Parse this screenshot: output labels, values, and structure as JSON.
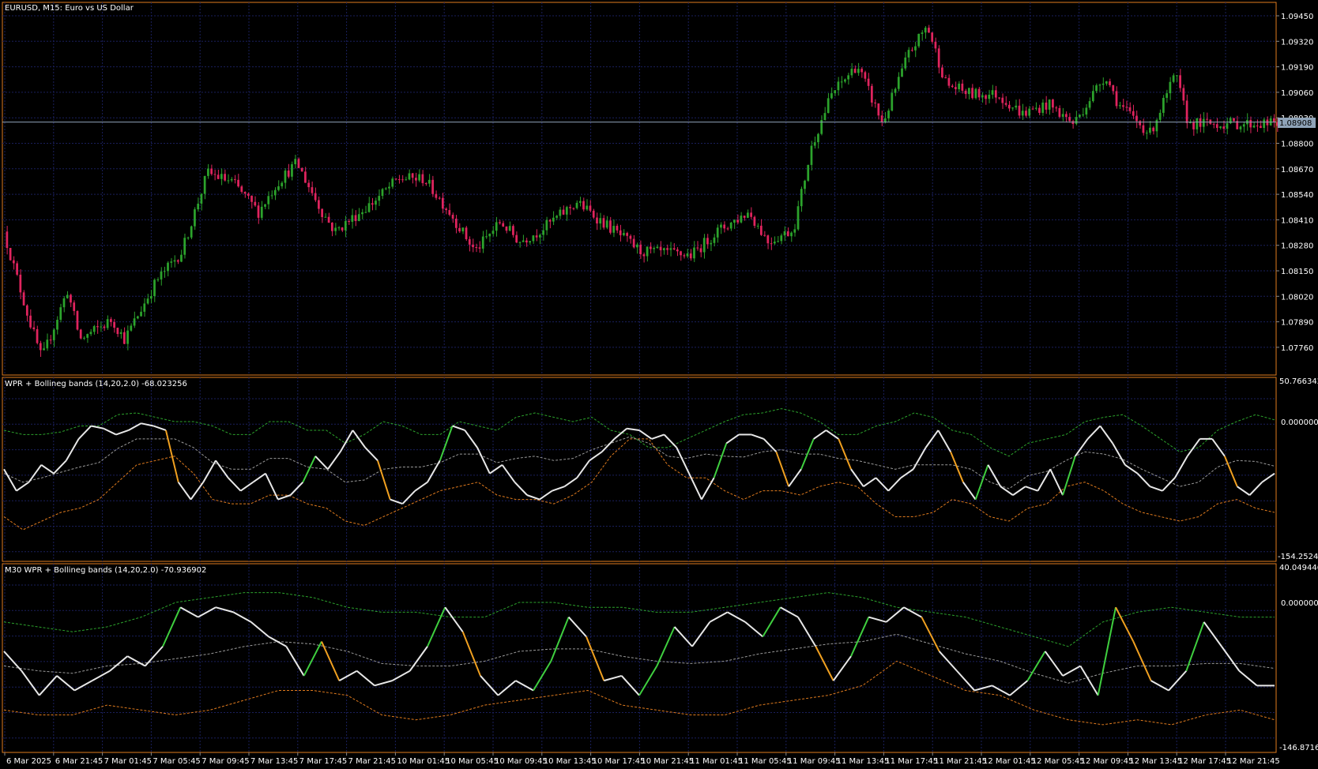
{
  "main": {
    "title": "EURUSD, M15:  Euro vs US Dollar",
    "price_axis": [
      "1.09450",
      "1.09320",
      "1.09190",
      "1.09060",
      "1.08930",
      "1.08800",
      "1.08670",
      "1.08540",
      "1.08410",
      "1.08280",
      "1.08150",
      "1.08020",
      "1.07890",
      "1.07760"
    ],
    "current_price": "1.08908",
    "colors": {
      "bull": "#2ca32c",
      "bear": "#e0245e",
      "grid": "#1a1f5c",
      "border": "#e07b1e",
      "price_line": "#8fa3b8"
    }
  },
  "ind1": {
    "title": "WPR + Bollineg bands (14,20,2.0) -68.023256",
    "axis_top": "50.766342",
    "axis_zero": "0.000000",
    "axis_bottom": "-154.252460"
  },
  "ind2": {
    "title": "M30 WPR + Bollineg bands (14,20,2.0) -70.936902",
    "axis_top": "40.049446",
    "axis_zero": "0.000000",
    "axis_bottom": "-146.871630"
  },
  "time_axis": [
    "6 Mar 2025",
    "6 Mar 21:45",
    "7 Mar 01:45",
    "7 Mar 05:45",
    "7 Mar 09:45",
    "7 Mar 13:45",
    "7 Mar 17:45",
    "7 Mar 21:45",
    "10 Mar 01:45",
    "10 Mar 05:45",
    "10 Mar 09:45",
    "10 Mar 13:45",
    "10 Mar 17:45",
    "10 Mar 21:45",
    "11 Mar 01:45",
    "11 Mar 05:45",
    "11 Mar 09:45",
    "11 Mar 13:45",
    "11 Mar 17:45",
    "11 Mar 21:45",
    "12 Mar 01:45",
    "12 Mar 05:45",
    "12 Mar 09:45",
    "12 Mar 13:45",
    "12 Mar 17:45",
    "12 Mar 21:45"
  ],
  "chart_data": {
    "type": "candlestick",
    "symbol": "EURUSD",
    "timeframe": "M15",
    "price_path": [
      [
        0,
        1.0835
      ],
      [
        0.02,
        1.079
      ],
      [
        0.03,
        1.077
      ],
      [
        0.05,
        1.0805
      ],
      [
        0.06,
        1.078
      ],
      [
        0.085,
        1.079
      ],
      [
        0.095,
        1.078
      ],
      [
        0.12,
        1.081
      ],
      [
        0.14,
        1.0825
      ],
      [
        0.16,
        1.0865
      ],
      [
        0.18,
        1.086
      ],
      [
        0.2,
        1.0845
      ],
      [
        0.215,
        1.086
      ],
      [
        0.23,
        1.087
      ],
      [
        0.25,
        1.0845
      ],
      [
        0.26,
        1.0835
      ],
      [
        0.29,
        1.085
      ],
      [
        0.31,
        1.0862
      ],
      [
        0.33,
        1.0862
      ],
      [
        0.35,
        1.0845
      ],
      [
        0.37,
        1.0825
      ],
      [
        0.39,
        1.084
      ],
      [
        0.405,
        1.083
      ],
      [
        0.42,
        1.0835
      ],
      [
        0.45,
        1.085
      ],
      [
        0.47,
        1.084
      ],
      [
        0.5,
        1.0825
      ],
      [
        0.54,
        1.0823
      ],
      [
        0.56,
        1.0835
      ],
      [
        0.585,
        1.0845
      ],
      [
        0.6,
        1.083
      ],
      [
        0.62,
        1.0836
      ],
      [
        0.635,
        1.088
      ],
      [
        0.65,
        1.0905
      ],
      [
        0.67,
        1.092
      ],
      [
        0.69,
        1.089
      ],
      [
        0.71,
        1.0925
      ],
      [
        0.725,
        1.094
      ],
      [
        0.74,
        1.091
      ],
      [
        0.76,
        1.0905
      ],
      [
        0.78,
        1.0905
      ],
      [
        0.8,
        1.0895
      ],
      [
        0.82,
        1.09
      ],
      [
        0.84,
        1.089
      ],
      [
        0.865,
        1.0915
      ],
      [
        0.875,
        1.09
      ],
      [
        0.9,
        1.0885
      ],
      [
        0.92,
        1.0915
      ],
      [
        0.93,
        1.089
      ],
      [
        0.945,
        1.089
      ],
      [
        0.96,
        1.089
      ]
    ],
    "ind1_series": {
      "wpr_current": -68.023256,
      "levels": {
        "max": 50.766342,
        "zero": 0,
        "min": -154.25246
      },
      "wpr_path": [
        -55,
        -80,
        -70,
        -50,
        -60,
        -45,
        -20,
        -5,
        -8,
        -15,
        -10,
        -2,
        -5,
        -10,
        -70,
        -90,
        -70,
        -45,
        -65,
        -80,
        -70,
        -60,
        -90,
        -85,
        -70,
        -40,
        -55,
        -35,
        -10,
        -30,
        -45,
        -90,
        -95,
        -80,
        -70,
        -45,
        -5,
        -10,
        -30,
        -60,
        -50,
        -70,
        -85,
        -90,
        -80,
        -75,
        -65,
        -45,
        -35,
        -20,
        -8,
        -10,
        -20,
        -15,
        -30,
        -60,
        -90,
        -65,
        -25,
        -15,
        -15,
        -20,
        -35,
        -75,
        -55,
        -20,
        -10,
        -20,
        -55,
        -75,
        -65,
        -80,
        -65,
        -55,
        -30,
        -10,
        -35,
        -70,
        -90,
        -50,
        -75,
        -85,
        -75,
        -80,
        -55,
        -85,
        -40,
        -20,
        -5,
        -25,
        -50,
        -60,
        -75,
        -80,
        -65,
        -40,
        -20,
        -20,
        -40,
        -75,
        -85,
        -70,
        -60
      ],
      "upper_path": [
        -10,
        -15,
        -15,
        -12,
        -5,
        -5,
        8,
        10,
        5,
        0,
        0,
        -5,
        -15,
        -15,
        0,
        0,
        -10,
        -10,
        -25,
        -15,
        0,
        -5,
        -15,
        -15,
        0,
        -5,
        -10,
        5,
        10,
        5,
        0,
        5,
        -10,
        -15,
        -30,
        -30,
        -20,
        -10,
        0,
        8,
        10,
        15,
        10,
        0,
        -15,
        -15,
        -5,
        0,
        10,
        5,
        -10,
        -15,
        -30,
        -40,
        -25,
        -20,
        -15,
        0,
        5,
        8,
        -5,
        -20,
        -35,
        -30,
        -10,
        0,
        8,
        2
      ],
      "lower_path": [
        -110,
        -125,
        -115,
        -105,
        -100,
        -90,
        -70,
        -50,
        -45,
        -40,
        -60,
        -90,
        -95,
        -95,
        -85,
        -85,
        -95,
        -100,
        -115,
        -120,
        -110,
        -100,
        -90,
        -80,
        -75,
        -70,
        -85,
        -90,
        -90,
        -95,
        -85,
        -70,
        -40,
        -20,
        -20,
        -50,
        -65,
        -65,
        -80,
        -90,
        -80,
        -80,
        -85,
        -75,
        -70,
        -75,
        -95,
        -110,
        -110,
        -105,
        -90,
        -95,
        -110,
        -115,
        -100,
        -95,
        -75,
        -70,
        -80,
        -95,
        -105,
        -110,
        -115,
        -110,
        -95,
        -90,
        -100,
        -105
      ]
    },
    "ind2_series": {
      "wpr_current": -70.936902,
      "levels": {
        "max": 40.049446,
        "zero": 0,
        "min": -146.87163
      },
      "wpr_path": [
        -50,
        -70,
        -95,
        -75,
        -90,
        -80,
        -70,
        -55,
        -65,
        -45,
        -5,
        -15,
        -5,
        -10,
        -20,
        -35,
        -45,
        -75,
        -40,
        -80,
        -70,
        -85,
        -80,
        -70,
        -45,
        -5,
        -30,
        -75,
        -95,
        -80,
        -90,
        -60,
        -15,
        -35,
        -80,
        -75,
        -95,
        -65,
        -25,
        -45,
        -20,
        -10,
        -20,
        -35,
        -5,
        -15,
        -45,
        -80,
        -55,
        -15,
        -20,
        -5,
        -15,
        -50,
        -70,
        -90,
        -85,
        -95,
        -80,
        -50,
        -75,
        -65,
        -95,
        -5,
        -40,
        -80,
        -90,
        -70,
        -20,
        -45,
        -70,
        -85,
        -85
      ],
      "upper_path": [
        -20,
        -25,
        -30,
        -25,
        -15,
        0,
        5,
        10,
        10,
        5,
        -5,
        -10,
        -10,
        -15,
        -15,
        0,
        0,
        -5,
        -5,
        -10,
        -10,
        -5,
        0,
        5,
        10,
        5,
        -5,
        -10,
        -15,
        -25,
        -35,
        -45,
        -20,
        -10,
        -5,
        -10,
        -15,
        -15
      ],
      "lower_path": [
        -110,
        -115,
        -115,
        -105,
        -110,
        -115,
        -110,
        -100,
        -90,
        -90,
        -95,
        -115,
        -120,
        -115,
        -105,
        -100,
        -95,
        -90,
        -105,
        -110,
        -115,
        -115,
        -105,
        -100,
        -95,
        -85,
        -60,
        -75,
        -90,
        -95,
        -110,
        -120,
        -125,
        -120,
        -125,
        -115,
        -110,
        -120
      ]
    }
  }
}
